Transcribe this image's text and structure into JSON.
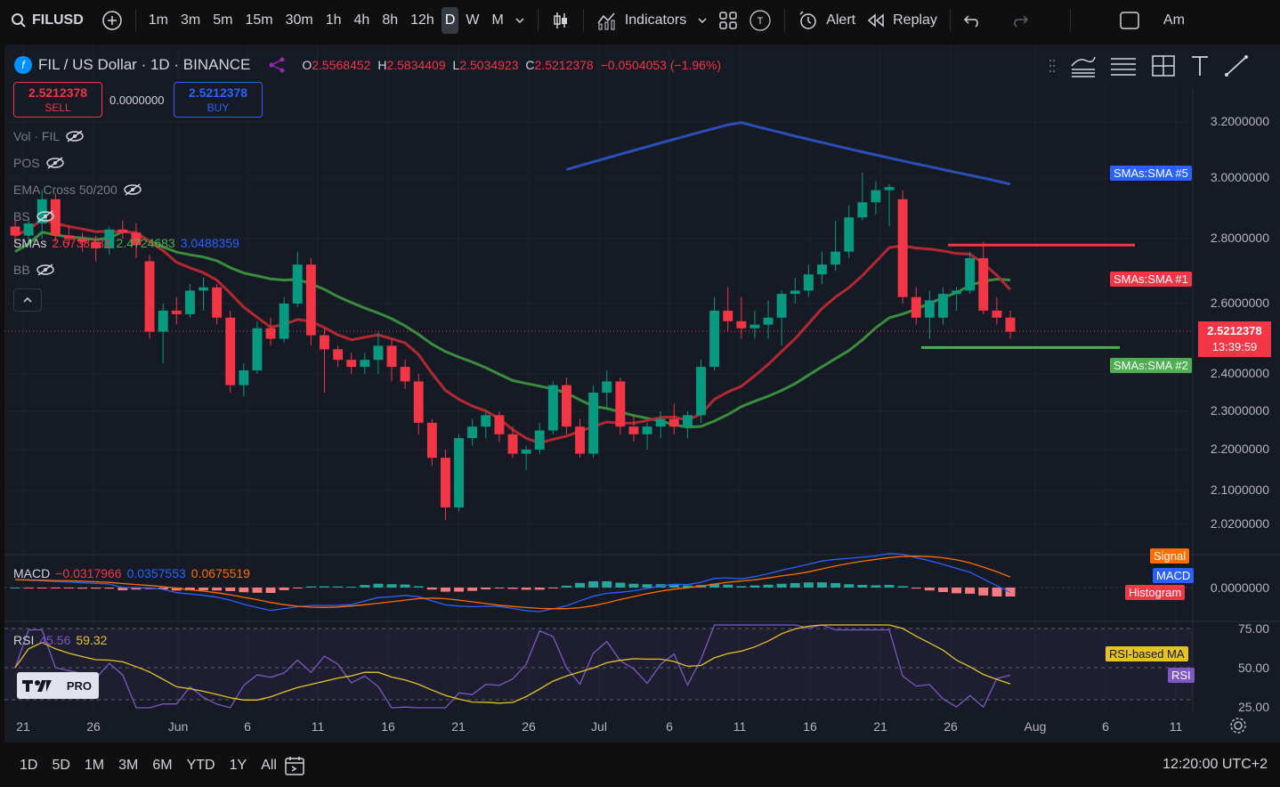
{
  "header": {
    "symbol": "FILUSD",
    "intervals": [
      "1m",
      "3m",
      "5m",
      "15m",
      "30m",
      "1h",
      "4h",
      "8h",
      "12h",
      "D",
      "W",
      "M"
    ],
    "active_interval": "D",
    "indicators_label": "Indicators",
    "alert_label": "Alert",
    "replay_label": "Replay",
    "truncated_label": "Am"
  },
  "legend": {
    "title": "FIL / US Dollar · 1D · BINANCE",
    "o_label": "O",
    "o": "2.5568452",
    "h_label": "H",
    "h": "2.5834409",
    "l_label": "L",
    "l": "2.5034923",
    "c_label": "C",
    "c": "2.5212378",
    "change": "−0.0504053 (−1.96%)",
    "vol": "Vol · FIL",
    "pos": "POS",
    "ema": "EMA Cross 50/200",
    "bs": "BS",
    "smas_label": "SMAs",
    "sma1": "2.6738731",
    "sma2": "2.4724683",
    "sma3": "3.0488359",
    "bb": "BB"
  },
  "trade": {
    "sell_price": "2.5212378",
    "sell_label": "SELL",
    "spread": "0.0000000",
    "buy_price": "2.5212378",
    "buy_label": "BUY"
  },
  "price_axis": [
    "3.2000000",
    "3.0000000",
    "2.8000000",
    "2.6000000",
    "2.4000000",
    "2.3000000",
    "2.2000000",
    "2.1000000",
    "2.0200000"
  ],
  "tags": {
    "sma5": "SMAs:SMA #5",
    "sma1": "SMAs:SMA #1",
    "sma2": "SMAs:SMA #2",
    "last_price": "2.5212378",
    "countdown": "13:39:59"
  },
  "macd": {
    "label": "MACD",
    "v1": "−0.0317966",
    "v2": "0.0357553",
    "v3": "0.0675519",
    "zero": "0.0000000",
    "signal_tag": "Signal",
    "macd_tag": "MACD",
    "hist_tag": "Histogram"
  },
  "rsi": {
    "label": "RSI",
    "v1": "45.56",
    "v2": "59.32",
    "levels": [
      "75.00",
      "50.00",
      "25.00"
    ],
    "ma_tag": "RSI-based MA",
    "rsi_tag": "RSI"
  },
  "logo_text": "PRO",
  "xaxis": [
    "21",
    "26",
    "Jun",
    "6",
    "11",
    "16",
    "21",
    "26",
    "Jul",
    "6",
    "11",
    "16",
    "21",
    "26",
    "Aug",
    "6",
    "11"
  ],
  "bottom": {
    "ranges": [
      "1D",
      "5D",
      "1M",
      "3M",
      "6M",
      "YTD",
      "1Y",
      "All"
    ],
    "time": "12:20:00 UTC+2"
  },
  "colors": {
    "up": "#089981",
    "down": "#f23645",
    "sma_red": "#b22833",
    "sma_green": "#388e3c",
    "sma_blue": "#2a4fb8",
    "macd": "#2962ff",
    "signal": "#ff6d00",
    "rsi": "#7e57c2",
    "rsi_ma": "#e6c229"
  },
  "chart_data": {
    "type": "candlestick",
    "title": "FIL / US Dollar · 1D · BINANCE",
    "ylim": [
      1.96,
      3.3
    ],
    "candles": [
      {
        "o": 2.84,
        "h": 2.88,
        "l": 2.78,
        "c": 2.81
      },
      {
        "o": 2.81,
        "h": 2.87,
        "l": 2.79,
        "c": 2.85
      },
      {
        "o": 2.85,
        "h": 2.96,
        "l": 2.8,
        "c": 2.93
      },
      {
        "o": 2.93,
        "h": 2.95,
        "l": 2.79,
        "c": 2.81
      },
      {
        "o": 2.81,
        "h": 2.84,
        "l": 2.78,
        "c": 2.8
      },
      {
        "o": 2.8,
        "h": 2.82,
        "l": 2.76,
        "c": 2.79
      },
      {
        "o": 2.79,
        "h": 2.81,
        "l": 2.73,
        "c": 2.77
      },
      {
        "o": 2.77,
        "h": 2.84,
        "l": 2.75,
        "c": 2.83
      },
      {
        "o": 2.83,
        "h": 2.86,
        "l": 2.8,
        "c": 2.82
      },
      {
        "o": 2.82,
        "h": 2.85,
        "l": 2.74,
        "c": 2.78
      },
      {
        "o": 2.73,
        "h": 2.75,
        "l": 2.5,
        "c": 2.52
      },
      {
        "o": 2.52,
        "h": 2.6,
        "l": 2.43,
        "c": 2.58
      },
      {
        "o": 2.58,
        "h": 2.62,
        "l": 2.54,
        "c": 2.57
      },
      {
        "o": 2.57,
        "h": 2.66,
        "l": 2.56,
        "c": 2.64
      },
      {
        "o": 2.64,
        "h": 2.68,
        "l": 2.58,
        "c": 2.65
      },
      {
        "o": 2.65,
        "h": 2.66,
        "l": 2.54,
        "c": 2.56
      },
      {
        "o": 2.56,
        "h": 2.58,
        "l": 2.35,
        "c": 2.37
      },
      {
        "o": 2.37,
        "h": 2.43,
        "l": 2.34,
        "c": 2.41
      },
      {
        "o": 2.41,
        "h": 2.55,
        "l": 2.4,
        "c": 2.53
      },
      {
        "o": 2.53,
        "h": 2.56,
        "l": 2.48,
        "c": 2.5
      },
      {
        "o": 2.5,
        "h": 2.62,
        "l": 2.49,
        "c": 2.6
      },
      {
        "o": 2.6,
        "h": 2.76,
        "l": 2.59,
        "c": 2.72
      },
      {
        "o": 2.72,
        "h": 2.74,
        "l": 2.48,
        "c": 2.51
      },
      {
        "o": 2.51,
        "h": 2.53,
        "l": 2.35,
        "c": 2.47
      },
      {
        "o": 2.47,
        "h": 2.48,
        "l": 2.42,
        "c": 2.44
      },
      {
        "o": 2.44,
        "h": 2.46,
        "l": 2.4,
        "c": 2.42
      },
      {
        "o": 2.42,
        "h": 2.46,
        "l": 2.4,
        "c": 2.44
      },
      {
        "o": 2.44,
        "h": 2.52,
        "l": 2.4,
        "c": 2.48
      },
      {
        "o": 2.48,
        "h": 2.5,
        "l": 2.38,
        "c": 2.42
      },
      {
        "o": 2.42,
        "h": 2.44,
        "l": 2.36,
        "c": 2.38
      },
      {
        "o": 2.38,
        "h": 2.4,
        "l": 2.24,
        "c": 2.27
      },
      {
        "o": 2.27,
        "h": 2.28,
        "l": 2.16,
        "c": 2.18
      },
      {
        "o": 2.18,
        "h": 2.2,
        "l": 2.03,
        "c": 2.06
      },
      {
        "o": 2.06,
        "h": 2.24,
        "l": 2.05,
        "c": 2.23
      },
      {
        "o": 2.23,
        "h": 2.28,
        "l": 2.21,
        "c": 2.26
      },
      {
        "o": 2.26,
        "h": 2.3,
        "l": 2.23,
        "c": 2.29
      },
      {
        "o": 2.29,
        "h": 2.3,
        "l": 2.22,
        "c": 2.24
      },
      {
        "o": 2.24,
        "h": 2.26,
        "l": 2.18,
        "c": 2.19
      },
      {
        "o": 2.19,
        "h": 2.21,
        "l": 2.15,
        "c": 2.2
      },
      {
        "o": 2.2,
        "h": 2.27,
        "l": 2.19,
        "c": 2.25
      },
      {
        "o": 2.25,
        "h": 2.38,
        "l": 2.24,
        "c": 2.37
      },
      {
        "o": 2.37,
        "h": 2.39,
        "l": 2.24,
        "c": 2.26
      },
      {
        "o": 2.26,
        "h": 2.28,
        "l": 2.18,
        "c": 2.19
      },
      {
        "o": 2.19,
        "h": 2.37,
        "l": 2.18,
        "c": 2.35
      },
      {
        "o": 2.35,
        "h": 2.41,
        "l": 2.31,
        "c": 2.38
      },
      {
        "o": 2.38,
        "h": 2.39,
        "l": 2.24,
        "c": 2.26
      },
      {
        "o": 2.26,
        "h": 2.29,
        "l": 2.22,
        "c": 2.24
      },
      {
        "o": 2.24,
        "h": 2.27,
        "l": 2.2,
        "c": 2.26
      },
      {
        "o": 2.26,
        "h": 2.3,
        "l": 2.23,
        "c": 2.28
      },
      {
        "o": 2.28,
        "h": 2.32,
        "l": 2.24,
        "c": 2.26
      },
      {
        "o": 2.26,
        "h": 2.3,
        "l": 2.23,
        "c": 2.29
      },
      {
        "o": 2.29,
        "h": 2.44,
        "l": 2.27,
        "c": 2.42
      },
      {
        "o": 2.42,
        "h": 2.62,
        "l": 2.41,
        "c": 2.58
      },
      {
        "o": 2.58,
        "h": 2.65,
        "l": 2.52,
        "c": 2.55
      },
      {
        "o": 2.55,
        "h": 2.62,
        "l": 2.5,
        "c": 2.53
      },
      {
        "o": 2.53,
        "h": 2.58,
        "l": 2.5,
        "c": 2.54
      },
      {
        "o": 2.54,
        "h": 2.61,
        "l": 2.5,
        "c": 2.56
      },
      {
        "o": 2.56,
        "h": 2.64,
        "l": 2.48,
        "c": 2.63
      },
      {
        "o": 2.63,
        "h": 2.68,
        "l": 2.6,
        "c": 2.64
      },
      {
        "o": 2.64,
        "h": 2.72,
        "l": 2.62,
        "c": 2.69
      },
      {
        "o": 2.69,
        "h": 2.76,
        "l": 2.66,
        "c": 2.72
      },
      {
        "o": 2.72,
        "h": 2.86,
        "l": 2.7,
        "c": 2.76
      },
      {
        "o": 2.76,
        "h": 2.91,
        "l": 2.74,
        "c": 2.87
      },
      {
        "o": 2.87,
        "h": 3.02,
        "l": 2.86,
        "c": 2.92
      },
      {
        "o": 2.92,
        "h": 2.99,
        "l": 2.88,
        "c": 2.96
      },
      {
        "o": 2.96,
        "h": 2.98,
        "l": 2.84,
        "c": 2.97
      },
      {
        "o": 2.93,
        "h": 2.96,
        "l": 2.6,
        "c": 2.62
      },
      {
        "o": 2.62,
        "h": 2.65,
        "l": 2.54,
        "c": 2.56
      },
      {
        "o": 2.56,
        "h": 2.64,
        "l": 2.5,
        "c": 2.61
      },
      {
        "o": 2.56,
        "h": 2.65,
        "l": 2.54,
        "c": 2.63
      },
      {
        "o": 2.63,
        "h": 2.65,
        "l": 2.58,
        "c": 2.64
      },
      {
        "o": 2.64,
        "h": 2.76,
        "l": 2.63,
        "c": 2.74
      },
      {
        "o": 2.74,
        "h": 2.79,
        "l": 2.57,
        "c": 2.58
      },
      {
        "o": 2.58,
        "h": 2.62,
        "l": 2.54,
        "c": 2.56
      },
      {
        "o": 2.56,
        "h": 2.58,
        "l": 2.5,
        "c": 2.52
      }
    ]
  }
}
